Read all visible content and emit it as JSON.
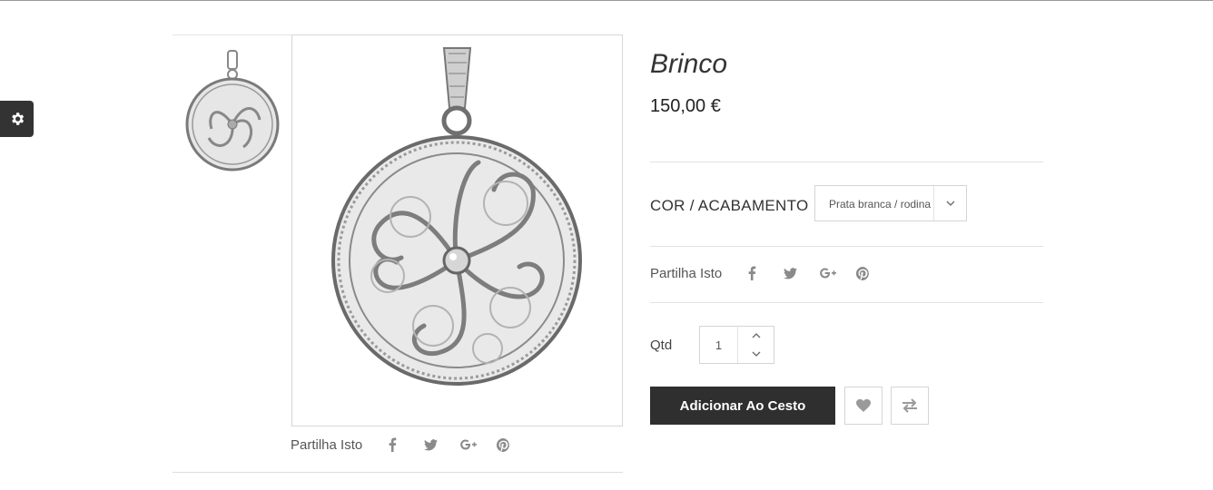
{
  "product": {
    "title": "Brinco",
    "price": "150,00 €"
  },
  "options": {
    "label": "COR / ACABAMENTO",
    "selected": "Prata branca / rodina"
  },
  "share": {
    "label": "Partilha Isto",
    "icons": [
      "facebook-icon",
      "twitter-icon",
      "google-plus-icon",
      "pinterest-icon"
    ]
  },
  "quantity": {
    "label": "Qtd",
    "value": "1"
  },
  "actions": {
    "add_to_cart": "Adicionar Ao Cesto",
    "wishlist_icon": "heart-icon",
    "compare_icon": "compare-arrows-icon"
  },
  "colors": {
    "button_bg": "#2f2f2f",
    "icon_gray": "#8a8a8a",
    "border": "#d5d5d5"
  }
}
